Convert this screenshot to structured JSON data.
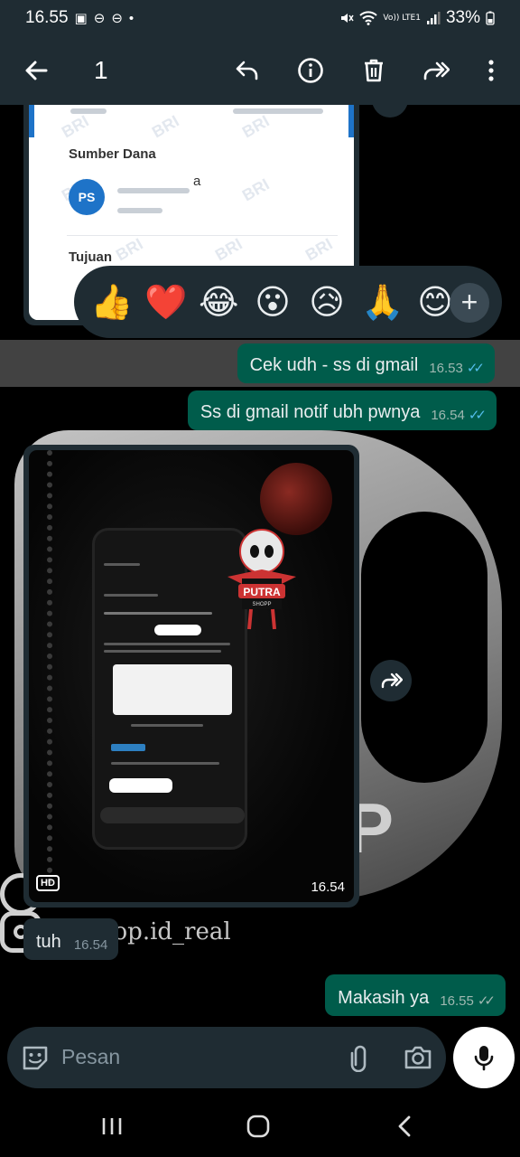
{
  "status_bar": {
    "time": "16.55",
    "battery": "33%",
    "network": "Vo)) LTE1",
    "icons": [
      "gallery-icon",
      "record-icon",
      "record-icon",
      "dot-icon",
      "mute-icon",
      "wifi-icon",
      "signal-icon",
      "battery-icon"
    ]
  },
  "action_bar": {
    "selected_count": "1",
    "icons": [
      "back-arrow-icon",
      "reply-icon",
      "info-icon",
      "delete-icon",
      "forward-icon",
      "more-icon"
    ]
  },
  "receipt": {
    "source_label": "Sumber Dana",
    "avatar_initials": "PS",
    "name_fragment": "a",
    "target_label": "Tujuan",
    "watermark": "BRI"
  },
  "reactions": {
    "emojis": [
      "👍",
      "❤️",
      "😂",
      "😮",
      "😥",
      "🙏",
      "😊"
    ],
    "more": "+"
  },
  "messages": [
    {
      "text": "Cek udh - ss di gmail",
      "time": "16.53",
      "status": "read"
    },
    {
      "text": "Ss di gmail notif ubh pwnya",
      "time": "16.54",
      "status": "read"
    },
    {
      "text": "tuh",
      "time": "16.54"
    },
    {
      "text": "Makasih ya",
      "time": "16.55",
      "status": "sent"
    }
  ],
  "photo": {
    "badge": "HD",
    "time": "16.54",
    "sticker_text": "PUTRA",
    "sticker_sub": "SHOPP"
  },
  "wallpaper": {
    "word": "PP",
    "handle": "p...shop.id_real"
  },
  "compose": {
    "placeholder": "Pesan"
  },
  "theme": {
    "header_bg": "#1f2c33",
    "outgoing_bubble": "#005c4b",
    "incoming_bubble": "#1f2c33",
    "read_tick": "#53bdeb"
  }
}
